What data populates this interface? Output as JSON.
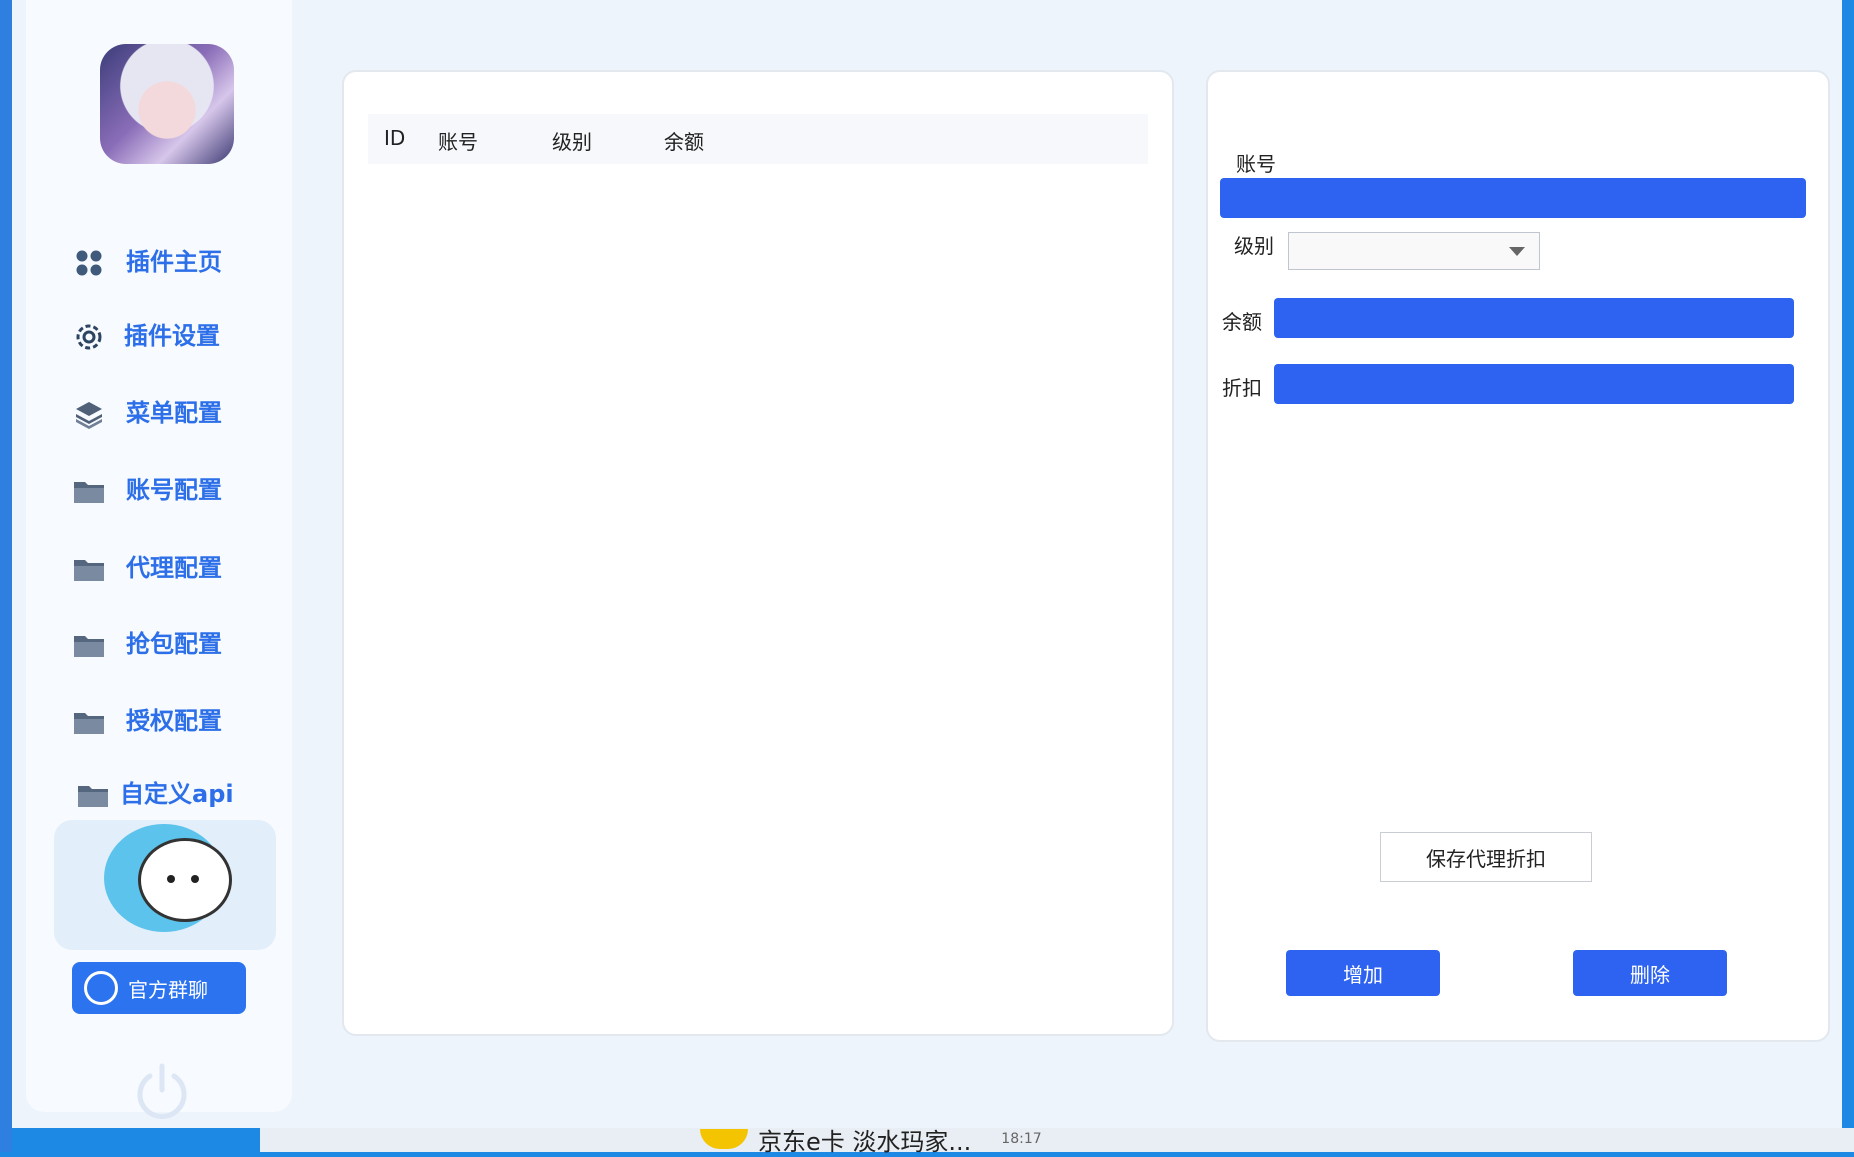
{
  "sidebar": {
    "items": [
      {
        "label": "插件主页",
        "icon": "grid-icon"
      },
      {
        "label": "插件设置",
        "icon": "gear-icon"
      },
      {
        "label": "菜单配置",
        "icon": "layers-icon"
      },
      {
        "label": "账号配置",
        "icon": "folder-icon"
      },
      {
        "label": "代理配置",
        "icon": "folder-icon"
      },
      {
        "label": "抢包配置",
        "icon": "folder-icon"
      },
      {
        "label": "授权配置",
        "icon": "folder-icon"
      },
      {
        "label": "自定义api",
        "icon": "folder-icon"
      }
    ],
    "chat_button": "官方群聊"
  },
  "table": {
    "columns": [
      "ID",
      "账号",
      "级别",
      "余额"
    ]
  },
  "form": {
    "account_label": "账号",
    "level_label": "级别",
    "level_value": "",
    "balance_label": "余额",
    "discount_label": "折扣",
    "save_button": "保存代理折扣",
    "add_button": "增加",
    "delete_button": "删除"
  },
  "taskbar": {
    "item_text": "京东e卡 淡水玛家...",
    "time": "18:17"
  },
  "colors": {
    "accent": "#2d63f0",
    "nav_text": "#2c6fe8",
    "background": "#eef4fc"
  }
}
